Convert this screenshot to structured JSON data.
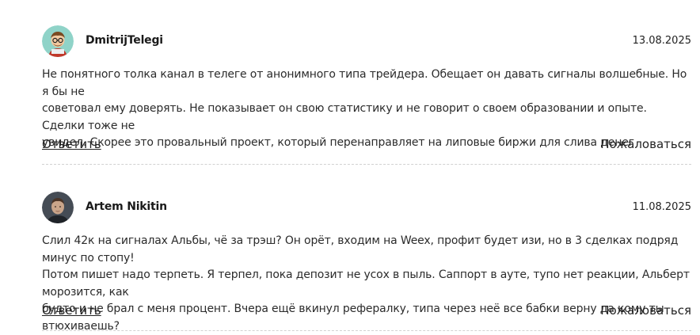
{
  "comments": [
    {
      "author": "DmitrijTelegi",
      "date": "13.08.2025",
      "avatar_icon": "cartoon-avatar-icon",
      "lines": [
        "Не понятного толка канал в телеге от анонимного типа трейдера. Обещает он давать сигналы волшебные. Но я бы не",
        "советовал ему доверять. Не показывает он свою статистику и не говорит о своем образовании и опыте. Сделки тоже не",
        "увидел. Скорее это провальный проект, который перенаправляет на липовые биржи для слива денег"
      ],
      "reply_label": "Ответить",
      "report_label": "Пожаловаться"
    },
    {
      "author": "Artem Nikitin",
      "date": "11.08.2025",
      "avatar_icon": "photo-avatar-icon",
      "lines": [
        "Слил 42к на сигналах Альбы, чё за трэш? Он орёт, входим на Weex, профит будет изи, но в 3 сделках подряд минус по стопу!",
        "Потом пишет надо терпеть. Я терпел, пока депозит не усох в пыль. Саппорт в ауте, тупо нет реакции, Альберт морозится, как",
        "будто и не брал с меня процент. Вчера ещё вкинул рефералку, типа через неё все бабки верну да кому ты втюхиваешь?"
      ],
      "reply_label": "Ответить",
      "report_label": "Пожаловаться"
    }
  ]
}
